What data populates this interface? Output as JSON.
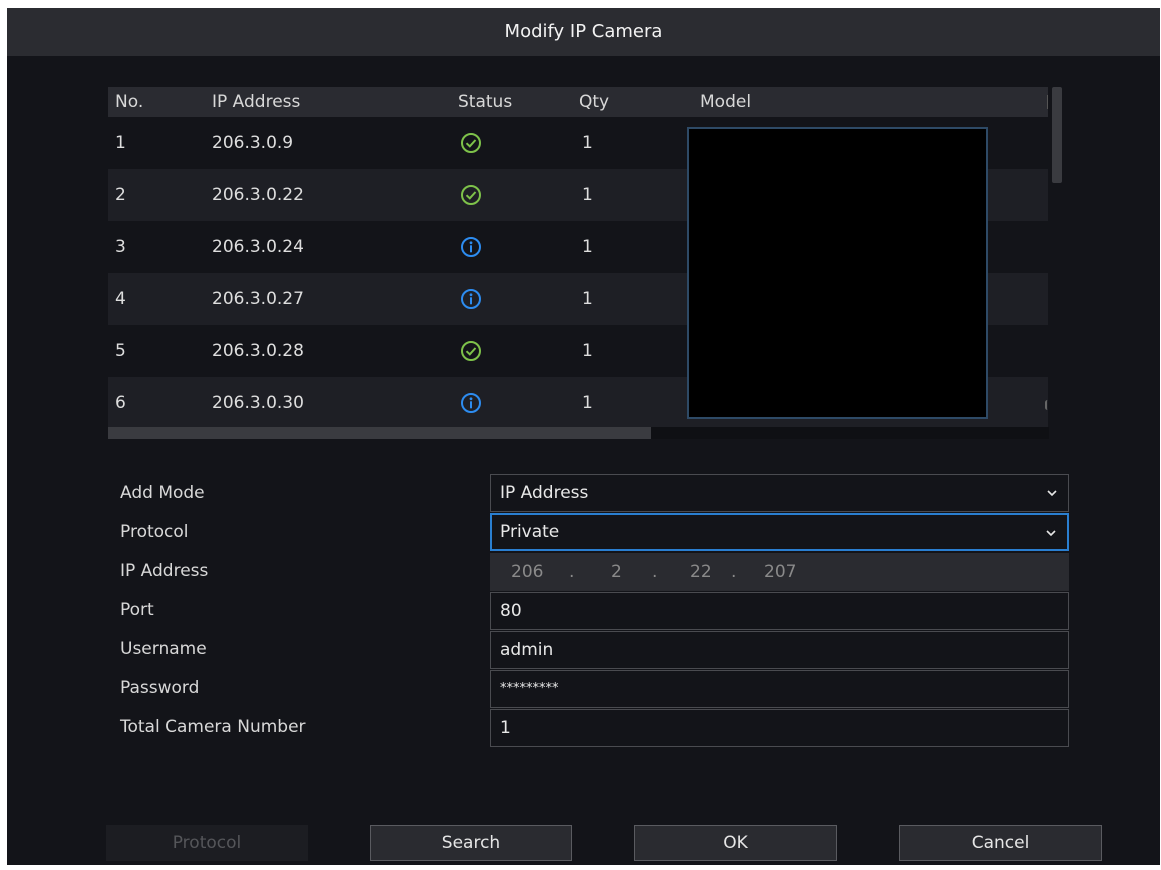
{
  "dialog": {
    "title": "Modify IP Camera"
  },
  "table": {
    "columns": [
      "No.",
      "IP Address",
      "Status",
      "Qty",
      "Model"
    ],
    "rows": [
      {
        "no": "1",
        "ip": "206.3.0.9",
        "status": "ok",
        "qty": "1"
      },
      {
        "no": "2",
        "ip": "206.3.0.22",
        "status": "ok",
        "qty": "1"
      },
      {
        "no": "3",
        "ip": "206.3.0.24",
        "status": "info",
        "qty": "1"
      },
      {
        "no": "4",
        "ip": "206.3.0.27",
        "status": "info",
        "qty": "1"
      },
      {
        "no": "5",
        "ip": "206.3.0.28",
        "status": "ok",
        "qty": "1"
      },
      {
        "no": "6",
        "ip": "206.3.0.30",
        "status": "info",
        "qty": "1"
      }
    ],
    "status_icons": {
      "ok": "check-circle-icon",
      "info": "info-circle-icon"
    },
    "status_colors": {
      "ok": "#7ec24a",
      "info": "#2d8cf0"
    }
  },
  "form": {
    "add_mode": {
      "label": "Add Mode",
      "value": "IP Address"
    },
    "protocol": {
      "label": "Protocol",
      "value": "Private"
    },
    "ip_address": {
      "label": "IP Address",
      "octets": [
        "206",
        "2",
        "22",
        "207"
      ]
    },
    "port": {
      "label": "Port",
      "value": "80"
    },
    "username": {
      "label": "Username",
      "value": "admin"
    },
    "password": {
      "label": "Password",
      "value": "*********"
    },
    "total_camera_number": {
      "label": "Total Camera Number",
      "value": "1"
    }
  },
  "buttons": {
    "protocol": "Protocol",
    "search": "Search",
    "ok": "OK",
    "cancel": "Cancel"
  },
  "colors": {
    "accent": "#2a7fd1",
    "background": "#131419"
  }
}
